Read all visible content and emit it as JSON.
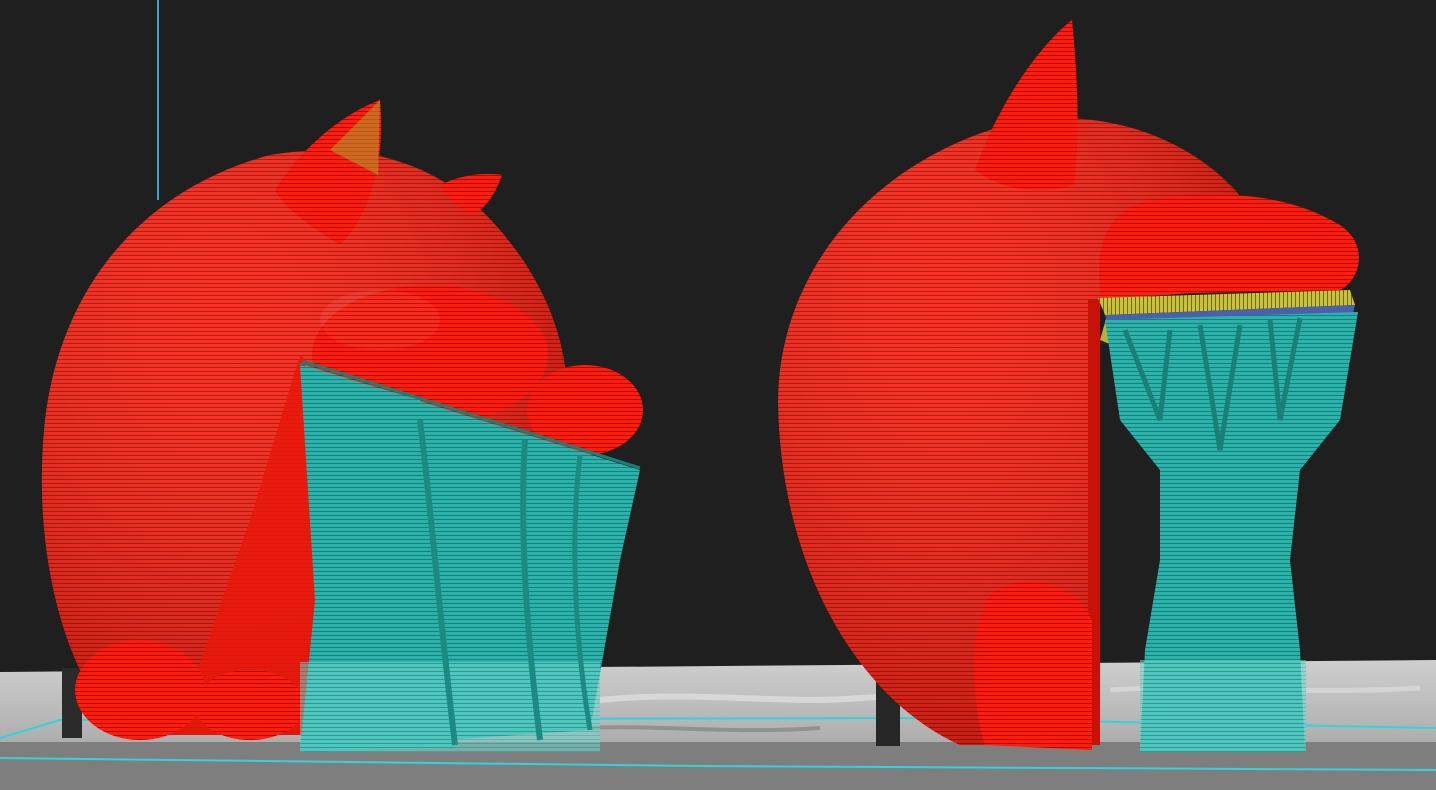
{
  "viewport": {
    "background_color": "#1f1f1f",
    "build_plate_color": "#b8b8b8",
    "plate_outline_color": "#2fd4e0",
    "axis_line_color": "#3aa6c9"
  },
  "legend_colors": {
    "wall": "#ff1a0a",
    "support": "#2bb5ad",
    "support_interface": "#b5b53a",
    "overhang_edge": "#4a5fb0"
  },
  "objects": [
    {
      "name": "left-model",
      "parts": [
        "body",
        "ear-left",
        "ear-right",
        "paw",
        "support"
      ]
    },
    {
      "name": "right-model",
      "parts": [
        "body",
        "ear",
        "foot",
        "paw",
        "support"
      ]
    }
  ]
}
